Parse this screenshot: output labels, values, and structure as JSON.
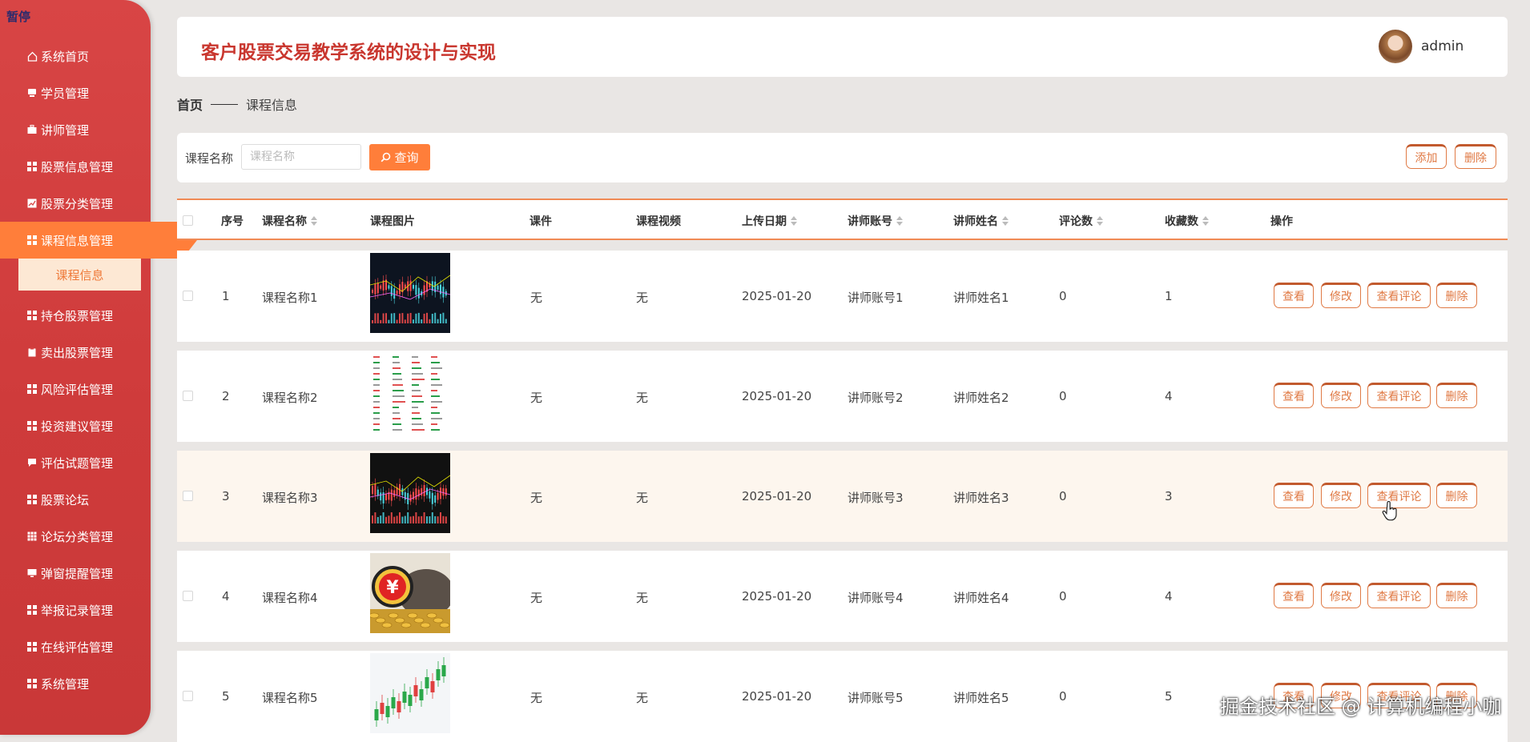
{
  "sidebar": {
    "badge": "暂停",
    "items": [
      {
        "label": "系统首页",
        "icon": "home-icon"
      },
      {
        "label": "学员管理",
        "icon": "user-card-icon"
      },
      {
        "label": "讲师管理",
        "icon": "briefcase-icon"
      },
      {
        "label": "股票信息管理",
        "icon": "grid-icon"
      },
      {
        "label": "股票分类管理",
        "icon": "chart-icon"
      },
      {
        "label": "课程信息管理",
        "icon": "grid-icon"
      },
      {
        "label": "持仓股票管理",
        "icon": "grid-icon"
      },
      {
        "label": "卖出股票管理",
        "icon": "clipboard-icon"
      },
      {
        "label": "风险评估管理",
        "icon": "grid-icon"
      },
      {
        "label": "投资建议管理",
        "icon": "grid-icon"
      },
      {
        "label": "评估试题管理",
        "icon": "comment-icon"
      },
      {
        "label": "股票论坛",
        "icon": "grid-icon"
      },
      {
        "label": "论坛分类管理",
        "icon": "table-icon"
      },
      {
        "label": "弹窗提醒管理",
        "icon": "monitor-icon"
      },
      {
        "label": "举报记录管理",
        "icon": "grid-icon"
      },
      {
        "label": "在线评估管理",
        "icon": "grid-icon"
      },
      {
        "label": "系统管理",
        "icon": "grid-icon"
      }
    ],
    "active_index": 5,
    "submenu_label": "课程信息"
  },
  "header": {
    "title": "客户股票交易教学系统的设计与实现",
    "user": "admin"
  },
  "breadcrumb": {
    "home": "首页",
    "current": "课程信息"
  },
  "search": {
    "label": "课程名称",
    "placeholder": "课程名称",
    "query_button": "查询",
    "add_button": "添加",
    "delete_button": "删除"
  },
  "table": {
    "headers": {
      "index": "序号",
      "name": "课程名称",
      "image": "课程图片",
      "courseware": "课件",
      "video": "课程视频",
      "date": "上传日期",
      "account": "讲师账号",
      "teacher": "讲师姓名",
      "comments": "评论数",
      "favorites": "收藏数",
      "actions": "操作"
    },
    "rows": [
      {
        "index": "1",
        "name": "课程名称1",
        "courseware": "无",
        "video": "无",
        "date": "2025-01-20",
        "account": "讲师账号1",
        "teacher": "讲师姓名1",
        "comments": "0",
        "favorites": "1"
      },
      {
        "index": "2",
        "name": "课程名称2",
        "courseware": "无",
        "video": "无",
        "date": "2025-01-20",
        "account": "讲师账号2",
        "teacher": "讲师姓名2",
        "comments": "0",
        "favorites": "4"
      },
      {
        "index": "3",
        "name": "课程名称3",
        "courseware": "无",
        "video": "无",
        "date": "2025-01-20",
        "account": "讲师账号3",
        "teacher": "讲师姓名3",
        "comments": "0",
        "favorites": "3"
      },
      {
        "index": "4",
        "name": "课程名称4",
        "courseware": "无",
        "video": "无",
        "date": "2025-01-20",
        "account": "讲师账号4",
        "teacher": "讲师姓名4",
        "comments": "0",
        "favorites": "4"
      },
      {
        "index": "5",
        "name": "课程名称5",
        "courseware": "无",
        "video": "无",
        "date": "2025-01-20",
        "account": "讲师账号5",
        "teacher": "讲师姓名5",
        "comments": "0",
        "favorites": "5"
      }
    ],
    "row_actions": {
      "view": "查看",
      "edit": "修改",
      "view_comments": "查看评论",
      "delete": "删除"
    }
  },
  "watermark": "掘金技术社区 @ 计算机编程小咖",
  "colors": {
    "sidebar": "#d84545",
    "accent": "#ff7e3a",
    "title": "#c9372f",
    "button_border": "#e07a45"
  }
}
